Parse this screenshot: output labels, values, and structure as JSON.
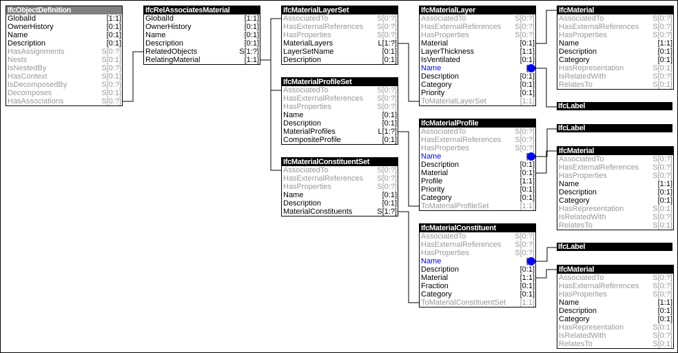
{
  "colors": {
    "header": "#000000",
    "abstract_header": "#808080",
    "derived_text": "#999999",
    "highlight": "#0000ff"
  },
  "boxes": [
    {
      "title": "IfcObjectDefinition",
      "abstract": true,
      "rows": [
        [
          "GlobalId",
          "[1:1]",
          "n"
        ],
        [
          "OwnerHistory",
          "[0:1]",
          "n"
        ],
        [
          "Name",
          "[0:1]",
          "n"
        ],
        [
          "Description",
          "[0:1]",
          "n"
        ],
        [
          "HasAssignments",
          "S[0:?]",
          "d"
        ],
        [
          "Nests",
          "S[0:1]",
          "d"
        ],
        [
          "IsNestedBy",
          "S[0:?]",
          "d"
        ],
        [
          "HasContext",
          "S[0:1]",
          "d"
        ],
        [
          "IsDecomposedBy",
          "S[0:?]",
          "d"
        ],
        [
          "Decomposes",
          "S[0:1]",
          "d"
        ],
        [
          "HasAssociations",
          "S[0:?]",
          "d"
        ]
      ]
    },
    {
      "title": "IfcRelAssociatesMaterial",
      "rows": [
        [
          "GlobalId",
          "[1:1]",
          "n"
        ],
        [
          "OwnerHistory",
          "[0:1]",
          "n"
        ],
        [
          "Name",
          "[0:1]",
          "n"
        ],
        [
          "Description",
          "[0:1]",
          "n"
        ],
        [
          "RelatedObjects",
          "S[1:?]",
          "n"
        ],
        [
          "RelatingMaterial",
          "[1:1]",
          "n"
        ]
      ]
    },
    {
      "title": "IfcMaterialLayerSet",
      "rows": [
        [
          "AssociatedTo",
          "S[0:?]",
          "d"
        ],
        [
          "HasExternalReferences",
          "S[0:?]",
          "d"
        ],
        [
          "HasProperties",
          "S[0:?]",
          "d"
        ],
        [
          "MaterialLayers",
          "L[1:?]",
          "n"
        ],
        [
          "LayerSetName",
          "[0:1]",
          "n"
        ],
        [
          "Description",
          "[0:1]",
          "n"
        ]
      ]
    },
    {
      "title": "IfcMaterialProfileSet",
      "rows": [
        [
          "AssociatedTo",
          "S[0:?]",
          "d"
        ],
        [
          "HasExternalReferences",
          "S[0:?]",
          "d"
        ],
        [
          "HasProperties",
          "S[0:?]",
          "d"
        ],
        [
          "Name",
          "[0:1]",
          "n"
        ],
        [
          "Description",
          "[0:1]",
          "n"
        ],
        [
          "MaterialProfiles",
          "L[1:?]",
          "n"
        ],
        [
          "CompositeProfile",
          "[0:1]",
          "n"
        ]
      ]
    },
    {
      "title": "IfcMaterialConstituentSet",
      "rows": [
        [
          "AssociatedTo",
          "S[0:?]",
          "d"
        ],
        [
          "HasExternalReferences",
          "S[0:?]",
          "d"
        ],
        [
          "HasProperties",
          "S[0:?]",
          "d"
        ],
        [
          "Name",
          "[0:1]",
          "n"
        ],
        [
          "Description",
          "[0:1]",
          "n"
        ],
        [
          "MaterialConstituents",
          "S[1:?]",
          "n"
        ]
      ]
    },
    {
      "title": "IfcMaterialLayer",
      "rows": [
        [
          "AssociatedTo",
          "S[0:?]",
          "d"
        ],
        [
          "HasExternalReferences",
          "S[0:?]",
          "d"
        ],
        [
          "HasProperties",
          "S[0:?]",
          "d"
        ],
        [
          "Material",
          "[0:1]",
          "n"
        ],
        [
          "LayerThickness",
          "[1:1]",
          "n"
        ],
        [
          "IsVentilated",
          "[0:1]",
          "n"
        ],
        [
          "Name",
          "[0:",
          "h"
        ],
        [
          "Description",
          "[0:1]",
          "n"
        ],
        [
          "Category",
          "[0:1]",
          "n"
        ],
        [
          "Priority",
          "[0:1]",
          "n"
        ],
        [
          "ToMaterialLayerSet",
          "[1:1]",
          "d"
        ]
      ]
    },
    {
      "title": "IfcMaterialProfile",
      "rows": [
        [
          "AssociatedTo",
          "S[0:?]",
          "d"
        ],
        [
          "HasExternalReferences",
          "S[0:?]",
          "d"
        ],
        [
          "HasProperties",
          "S[0:?]",
          "d"
        ],
        [
          "Name",
          "[0:",
          "h"
        ],
        [
          "Description",
          "[0:1]",
          "n"
        ],
        [
          "Material",
          "[0:1]",
          "n"
        ],
        [
          "Profile",
          "[1:1]",
          "n"
        ],
        [
          "Priority",
          "[0:1]",
          "n"
        ],
        [
          "Category",
          "[0:1]",
          "n"
        ],
        [
          "ToMaterialProfileSet",
          "[1:1]",
          "d"
        ]
      ]
    },
    {
      "title": "IfcMaterialConstituent",
      "rows": [
        [
          "AssociatedTo",
          "S[0:?]",
          "d"
        ],
        [
          "HasExternalReferences",
          "S[0:?]",
          "d"
        ],
        [
          "HasProperties",
          "S[0:?]",
          "d"
        ],
        [
          "Name",
          "[0:",
          "h"
        ],
        [
          "Description",
          "[0:1]",
          "n"
        ],
        [
          "Material",
          "[1:1]",
          "n"
        ],
        [
          "Fraction",
          "[0:1]",
          "n"
        ],
        [
          "Category",
          "[0:1]",
          "n"
        ],
        [
          "ToMaterialConstituentSet",
          "[1:1]",
          "d"
        ]
      ]
    },
    {
      "title": "IfcMaterial",
      "rows": [
        [
          "AssociatedTo",
          "S[0:?]",
          "d"
        ],
        [
          "HasExternalReferences",
          "S[0:?]",
          "d"
        ],
        [
          "HasProperties",
          "S[0:?]",
          "d"
        ],
        [
          "Name",
          "[1:1]",
          "n"
        ],
        [
          "Description",
          "[0:1]",
          "n"
        ],
        [
          "Category",
          "[0:1]",
          "n"
        ],
        [
          "HasRepresentation",
          "S[0:1]",
          "d"
        ],
        [
          "IsRelatedWith",
          "S[0:?]",
          "d"
        ],
        [
          "RelatesTo",
          "S[0:1]",
          "d"
        ]
      ]
    },
    {
      "title": "IfcLabel",
      "rows": []
    },
    {
      "title": "IfcLabel",
      "rows": []
    },
    {
      "title": "IfcMaterial",
      "rows": [
        [
          "AssociatedTo",
          "S[0:?]",
          "d"
        ],
        [
          "HasExternalReferences",
          "S[0:?]",
          "d"
        ],
        [
          "HasProperties",
          "S[0:?]",
          "d"
        ],
        [
          "Name",
          "[1:1]",
          "n"
        ],
        [
          "Description",
          "[0:1]",
          "n"
        ],
        [
          "Category",
          "[0:1]",
          "n"
        ],
        [
          "HasRepresentation",
          "S[0:1]",
          "d"
        ],
        [
          "IsRelatedWith",
          "S[0:?]",
          "d"
        ],
        [
          "RelatesTo",
          "S[0:1]",
          "d"
        ]
      ]
    },
    {
      "title": "IfcLabel",
      "rows": []
    },
    {
      "title": "IfcMaterial",
      "rows": [
        [
          "AssociatedTo",
          "S[0:?]",
          "d"
        ],
        [
          "HasExternalReferences",
          "S[0:?]",
          "d"
        ],
        [
          "HasProperties",
          "S[0:?]",
          "d"
        ],
        [
          "Name",
          "[1:1]",
          "n"
        ],
        [
          "Description",
          "[0:1]",
          "n"
        ],
        [
          "Category",
          "[0:1]",
          "n"
        ],
        [
          "HasRepresentation",
          "S[0:1]",
          "d"
        ],
        [
          "IsRelatedWith",
          "S[0:?]",
          "d"
        ],
        [
          "RelatesTo",
          "S[0:1]",
          "d"
        ]
      ]
    }
  ]
}
